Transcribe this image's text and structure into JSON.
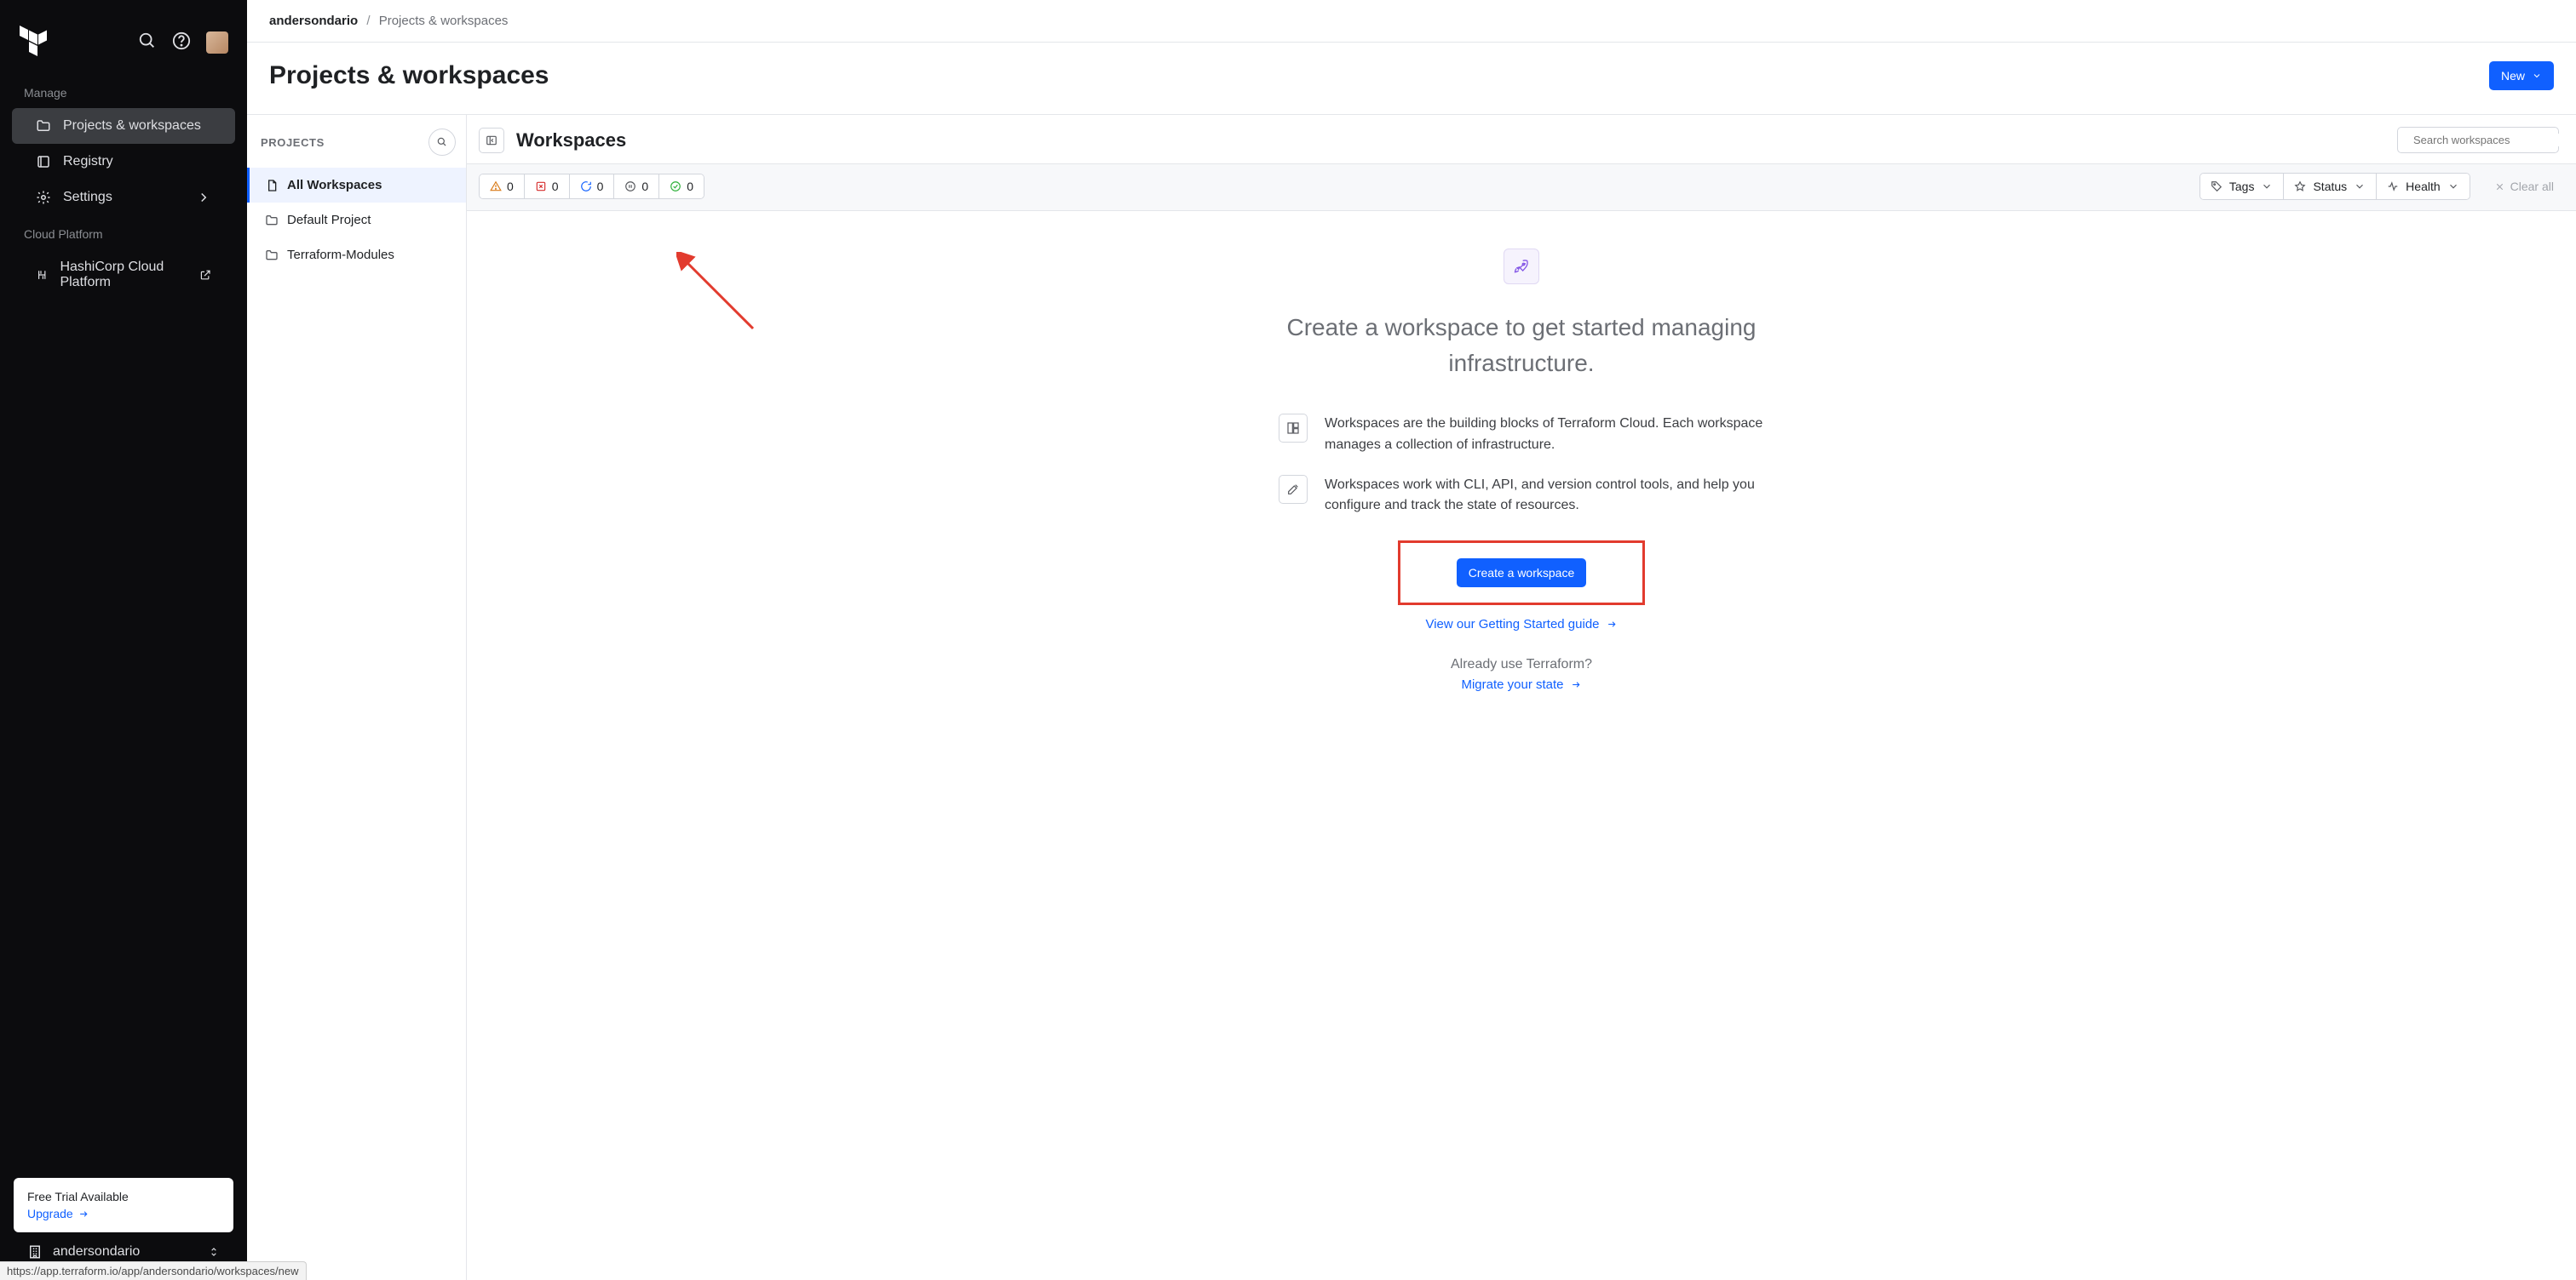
{
  "sidebar": {
    "sections": {
      "manage": {
        "label": "Manage"
      },
      "cloud": {
        "label": "Cloud Platform"
      }
    },
    "items": {
      "projects": "Projects & workspaces",
      "registry": "Registry",
      "settings": "Settings",
      "hcp": "HashiCorp Cloud Platform"
    },
    "trial": {
      "title": "Free Trial Available",
      "upgrade": "Upgrade"
    },
    "org": "andersondario"
  },
  "breadcrumb": {
    "org": "andersondario",
    "page": "Projects & workspaces"
  },
  "page": {
    "title": "Projects & workspaces",
    "newBtn": "New"
  },
  "projectsPanel": {
    "label": "PROJECTS",
    "items": [
      {
        "label": "All Workspaces",
        "icon": "file",
        "active": true
      },
      {
        "label": "Default Project",
        "icon": "folder",
        "active": false
      },
      {
        "label": "Terraform-Modules",
        "icon": "folder",
        "active": false
      }
    ]
  },
  "wsPanel": {
    "title": "Workspaces",
    "searchPlaceholder": "Search workspaces",
    "status": {
      "warn": "0",
      "error": "0",
      "running": "0",
      "paused": "0",
      "ok": "0"
    },
    "filters": {
      "tags": "Tags",
      "status": "Status",
      "health": "Health",
      "clear": "Clear all"
    },
    "empty": {
      "title": "Create a workspace to get started managing infrastructure.",
      "p1": "Workspaces are the building blocks of Terraform Cloud. Each workspace manages a collection of infrastructure.",
      "p2": "Workspaces work with CLI, API, and version control tools, and help you configure and track the state of resources.",
      "cta": "Create a workspace",
      "guide": "View our Getting Started guide",
      "already": "Already use Terraform?",
      "migrate": "Migrate your state"
    }
  },
  "statusUrl": "https://app.terraform.io/app/andersondario/workspaces/new"
}
